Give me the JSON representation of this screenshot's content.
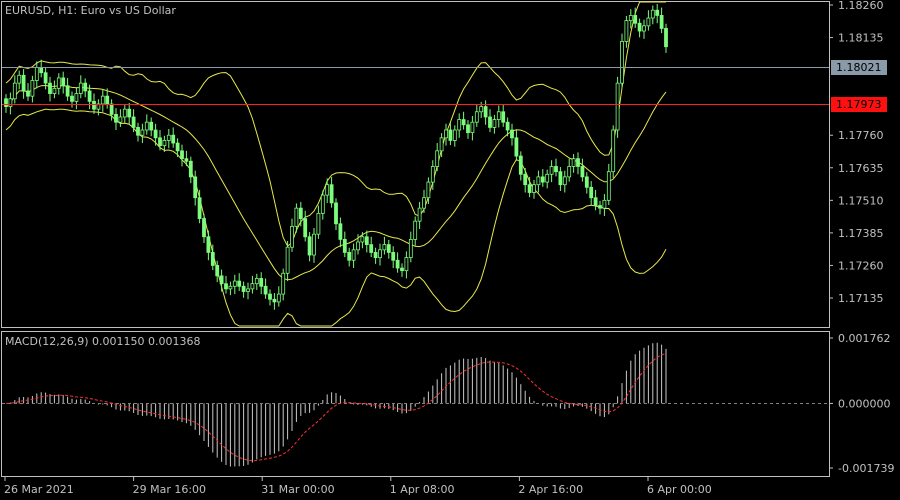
{
  "chart_header": {
    "symbol": "EURUSD",
    "timeframe": "H1",
    "description": "Euro vs US Dollar",
    "title": "EURUSD, H1:  Euro vs US Dollar"
  },
  "price_axis": {
    "ticks": [
      "1.18260",
      "1.18135",
      "1.17760",
      "1.17635",
      "1.17510",
      "1.17385",
      "1.17260",
      "1.17135"
    ],
    "tick_values": [
      1.1826,
      1.18135,
      1.1776,
      1.17635,
      1.1751,
      1.17385,
      1.1726,
      1.17135
    ],
    "bid_label": "1.18021",
    "bid_value": 1.18021,
    "level_label": "1.17973",
    "level_value": 1.17973
  },
  "macd": {
    "label": "MACD(12,26,9) 0.001150 0.001368",
    "ticks": [
      "0.001762",
      "0.000000",
      "-0.001739"
    ],
    "tick_values": [
      0.001762,
      0.0,
      -0.001739
    ]
  },
  "time_axis": {
    "labels": [
      "26 Mar 2021",
      "29 Mar 16:00",
      "31 Mar 00:00",
      "1 Apr 08:00",
      "2 Apr 16:00",
      "6 Apr 00:00"
    ]
  },
  "colors": {
    "background": "#000000",
    "candle": "#7cfc7c",
    "bollinger": "#e8e84a",
    "level_line": "#ff2020",
    "bid_line": "#8a9aa8",
    "macd_hist": "#c8c8c8",
    "macd_signal": "#ff3030",
    "grid_text": "#c0c0c0"
  },
  "chart_data": {
    "type": "candlestick",
    "series": [
      {
        "name": "EURUSD",
        "closes": [
          1.1787,
          1.179,
          1.1796,
          1.1799,
          1.1793,
          1.1791,
          1.1797,
          1.1802,
          1.18,
          1.1796,
          1.1792,
          1.1794,
          1.1798,
          1.1795,
          1.1791,
          1.1789,
          1.1792,
          1.1796,
          1.1793,
          1.1789,
          1.1786,
          1.1788,
          1.1791,
          1.1788,
          1.1784,
          1.1781,
          1.1783,
          1.1786,
          1.1783,
          1.1779,
          1.1776,
          1.1778,
          1.1781,
          1.1778,
          1.1775,
          1.1772,
          1.1774,
          1.1776,
          1.1773,
          1.177,
          1.1767,
          1.1766,
          1.176,
          1.1752,
          1.1744,
          1.1737,
          1.1731,
          1.1726,
          1.1722,
          1.1719,
          1.1717,
          1.1718,
          1.172,
          1.1718,
          1.1716,
          1.1717,
          1.1719,
          1.1721,
          1.1718,
          1.1715,
          1.1713,
          1.1712,
          1.1715,
          1.1723,
          1.1733,
          1.1741,
          1.1748,
          1.1744,
          1.1737,
          1.173,
          1.1738,
          1.1746,
          1.1753,
          1.1757,
          1.175,
          1.1742,
          1.1736,
          1.1731,
          1.1728,
          1.1732,
          1.1735,
          1.1737,
          1.1734,
          1.1731,
          1.1729,
          1.1732,
          1.1734,
          1.1731,
          1.1728,
          1.1725,
          1.1724,
          1.1729,
          1.1736,
          1.1743,
          1.1748,
          1.1752,
          1.1758,
          1.1764,
          1.177,
          1.1775,
          1.1778,
          1.1774,
          1.1778,
          1.1782,
          1.178,
          1.1777,
          1.1781,
          1.1785,
          1.1787,
          1.1783,
          1.1779,
          1.1782,
          1.1785,
          1.1781,
          1.1778,
          1.1775,
          1.1768,
          1.1761,
          1.1757,
          1.1754,
          1.1757,
          1.176,
          1.1758,
          1.1761,
          1.1764,
          1.1762,
          1.1757,
          1.176,
          1.1764,
          1.1767,
          1.1764,
          1.176,
          1.1756,
          1.1752,
          1.1749,
          1.1748,
          1.1751,
          1.1762,
          1.1778,
          1.1796,
          1.1812,
          1.182,
          1.1822,
          1.1819,
          1.1816,
          1.1818,
          1.1821,
          1.1824,
          1.1822,
          1.1817,
          1.181
        ]
      },
      {
        "name": "BB",
        "upper_start": 1.1808,
        "lower_end": 1.1728
      }
    ]
  }
}
